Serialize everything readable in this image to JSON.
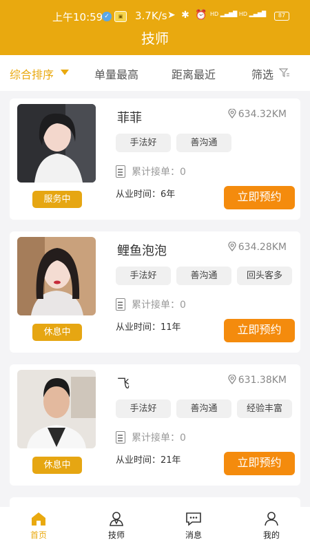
{
  "status_bar": {
    "time": "上午10:59",
    "speed": "3.7K/s",
    "battery": "87"
  },
  "header": {
    "title": "技师"
  },
  "filters": {
    "sort": "综合排序",
    "orders_high": "单量最高",
    "distance_near": "距离最近",
    "filter": "筛选"
  },
  "labels": {
    "orders_prefix": "累计接单：",
    "years_prefix": "从业时间：",
    "book": "立即预约"
  },
  "technicians": [
    {
      "name": "菲菲",
      "distance": "634.32KM",
      "tags": [
        "手法好",
        "善沟通"
      ],
      "orders": "0",
      "years": "6年",
      "status": "服务中"
    },
    {
      "name": "鲤鱼泡泡",
      "distance": "634.28KM",
      "tags": [
        "手法好",
        "善沟通",
        "回头客多"
      ],
      "orders": "0",
      "years": "11年",
      "status": "休息中"
    },
    {
      "name": "飞",
      "distance": "631.38KM",
      "tags": [
        "手法好",
        "善沟通",
        "经验丰富"
      ],
      "orders": "0",
      "years": "21年",
      "status": "休息中"
    }
  ],
  "tabbar": [
    {
      "label": "首页",
      "icon": "home-icon",
      "active": true
    },
    {
      "label": "技师",
      "icon": "technician-icon",
      "active": false
    },
    {
      "label": "消息",
      "icon": "message-icon",
      "active": false
    },
    {
      "label": "我的",
      "icon": "profile-icon",
      "active": false
    }
  ],
  "colors": {
    "accent": "#e9a90f",
    "book_button": "#f48b0d"
  }
}
